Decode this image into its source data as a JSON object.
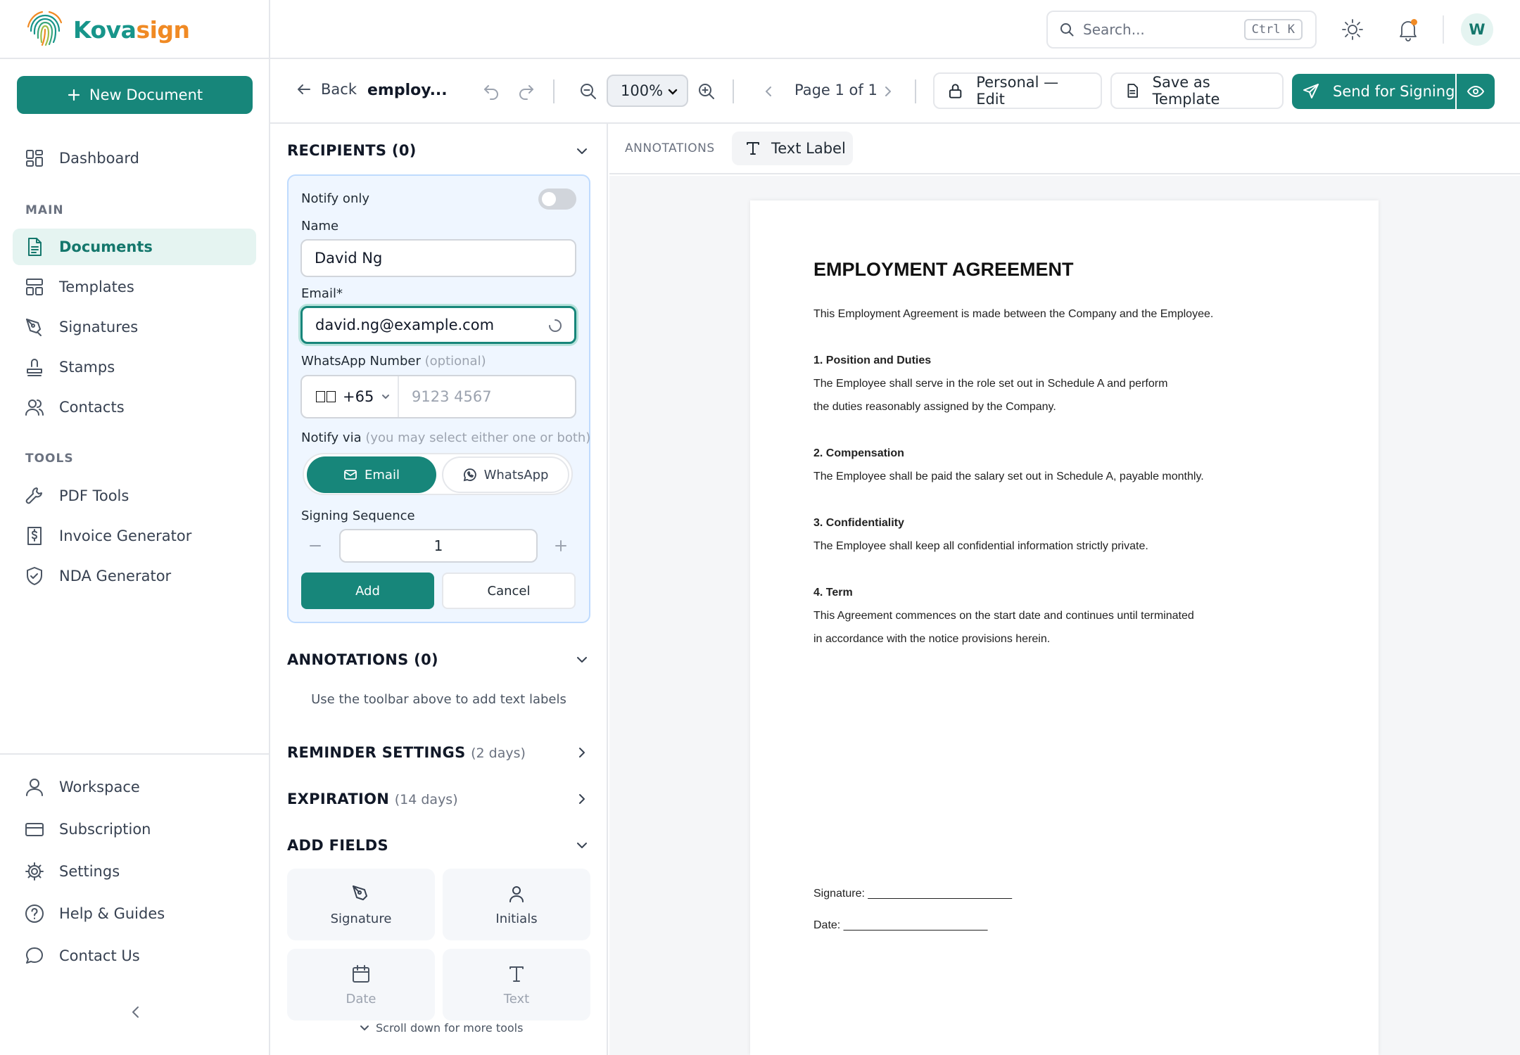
{
  "brand": {
    "name_part1": "Kova",
    "name_part2": "sign"
  },
  "sidebar": {
    "new_document": "New Document",
    "dashboard": "Dashboard",
    "section_main": "MAIN",
    "section_tools": "TOOLS",
    "items_main": [
      {
        "label": "Documents",
        "icon": "document-icon",
        "active": true
      },
      {
        "label": "Templates",
        "icon": "template-icon"
      },
      {
        "label": "Signatures",
        "icon": "pen-nib-icon"
      },
      {
        "label": "Stamps",
        "icon": "stamp-icon"
      },
      {
        "label": "Contacts",
        "icon": "users-icon"
      }
    ],
    "items_tools": [
      {
        "label": "PDF Tools",
        "icon": "wrench-icon"
      },
      {
        "label": "Invoice Generator",
        "icon": "invoice-icon"
      },
      {
        "label": "NDA Generator",
        "icon": "shield-check-icon"
      }
    ],
    "items_bottom": [
      {
        "label": "Workspace",
        "icon": "user-icon"
      },
      {
        "label": "Subscription",
        "icon": "credit-card-icon"
      },
      {
        "label": "Settings",
        "icon": "gear-icon"
      },
      {
        "label": "Help & Guides",
        "icon": "help-circle-icon"
      },
      {
        "label": "Contact Us",
        "icon": "chat-bubble-icon"
      }
    ]
  },
  "topbar": {
    "search_placeholder": "Search...",
    "search_shortcut": "Ctrl K",
    "avatar_initial": "W"
  },
  "toolbar": {
    "back": "Back",
    "doc_name": "employ...",
    "zoom": "100%",
    "page_indicator": "Page 1 of 1",
    "mode": "Personal — Edit",
    "save_template": "Save as Template",
    "send": "Send for Signing"
  },
  "panel": {
    "recipients_title": "RECIPIENTS (0)",
    "notify_only": "Notify only",
    "name_label": "Name",
    "name_value": "David Ng",
    "email_label": "Email*",
    "email_value": "david.ng@example.com",
    "whatsapp_label": "WhatsApp Number",
    "whatsapp_optional": "(optional)",
    "country_code": "+65",
    "phone_placeholder": "9123 4567",
    "notify_via_label": "Notify via",
    "notify_via_hint": "(you may select either one or both)",
    "notify_email": "Email",
    "notify_whatsapp": "WhatsApp",
    "sequence_label": "Signing Sequence",
    "sequence_value": "1",
    "add": "Add",
    "cancel": "Cancel",
    "annotations_title": "ANNOTATIONS (0)",
    "annotations_hint": "Use the toolbar above to add text labels",
    "reminder_title": "REMINDER SETTINGS",
    "reminder_value": "(2 days)",
    "expiration_title": "EXPIRATION",
    "expiration_value": "(14 days)",
    "add_fields_title": "ADD FIELDS",
    "fields": [
      "Signature",
      "Initials",
      "Date",
      "Text"
    ],
    "scroll_hint": "Scroll down for more tools"
  },
  "canvas": {
    "annotations_label": "ANNOTATIONS",
    "text_label_button": "Text Label"
  },
  "document": {
    "title": "EMPLOYMENT AGREEMENT",
    "intro": "This Employment Agreement is made between the Company and the Employee.",
    "s1_head": "1. Position and Duties",
    "s1_l1": "The Employee shall serve in the role set out in Schedule A and perform",
    "s1_l2": "the duties reasonably assigned by the Company.",
    "s2_head": "2. Compensation",
    "s2_l1": "The Employee shall be paid the salary set out in Schedule A, payable monthly.",
    "s3_head": "3. Confidentiality",
    "s3_l1": "The Employee shall keep all confidential information strictly private.",
    "s4_head": "4. Term",
    "s4_l1": "This Agreement commences on the start date and continues until terminated",
    "s4_l2": "in accordance with the notice provisions herein.",
    "signature_line": "Signature: _______________________",
    "date_line": "Date: _______________________"
  },
  "colors": {
    "accent": "#17867a",
    "brand_orange": "#f08a24",
    "active_bg": "#e5f4f1"
  }
}
